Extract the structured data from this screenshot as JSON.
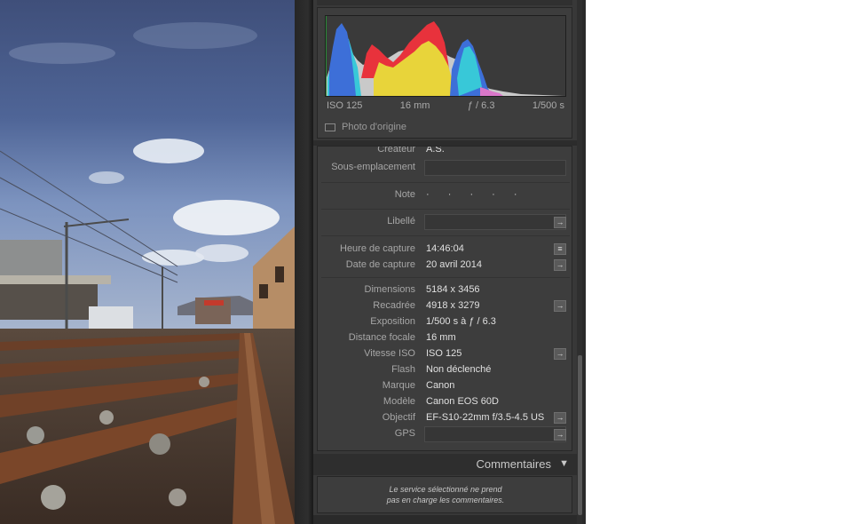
{
  "histogram": {
    "iso": "ISO 125",
    "focal": "16 mm",
    "aperture": "ƒ / 6.3",
    "shutter": "1/500 s",
    "original_label": "Photo d'origine"
  },
  "metadata": {
    "creator": {
      "label": "Créateur",
      "value": "A.S."
    },
    "sublocation": {
      "label": "Sous-emplacement",
      "value": ""
    },
    "rating": {
      "label": "Note",
      "value": "· · · · ·"
    },
    "caption": {
      "label": "Libellé",
      "value": ""
    },
    "capture_time": {
      "label": "Heure de capture",
      "value": "14:46:04"
    },
    "capture_date": {
      "label": "Date de capture",
      "value": "20 avril 2014"
    },
    "dimensions": {
      "label": "Dimensions",
      "value": "5184 x 3456"
    },
    "cropped": {
      "label": "Recadrée",
      "value": "4918 x 3279"
    },
    "exposure": {
      "label": "Exposition",
      "value": "1/500 s à ƒ / 6.3"
    },
    "focal_length": {
      "label": "Distance focale",
      "value": "16 mm"
    },
    "iso_speed": {
      "label": "Vitesse ISO",
      "value": "ISO 125"
    },
    "flash": {
      "label": "Flash",
      "value": "Non déclenché"
    },
    "make": {
      "label": "Marque",
      "value": "Canon"
    },
    "model": {
      "label": "Modèle",
      "value": "Canon EOS 60D"
    },
    "lens": {
      "label": "Objectif",
      "value": "EF-S10-22mm f/3.5-4.5 US"
    },
    "gps": {
      "label": "GPS",
      "value": ""
    }
  },
  "comments": {
    "title": "Commentaires",
    "line1": "Le service sélectionné ne prend",
    "line2": "pas en charge les commentaires."
  },
  "icons": {
    "go_arrow": "→",
    "list": "≡",
    "collapse": "▼"
  },
  "colors": {
    "panel_bg": "#383838",
    "histo_red": "#e8323c",
    "histo_yellow": "#e8d43a",
    "histo_blue": "#3d6fd8",
    "histo_cyan": "#38c8d8"
  }
}
